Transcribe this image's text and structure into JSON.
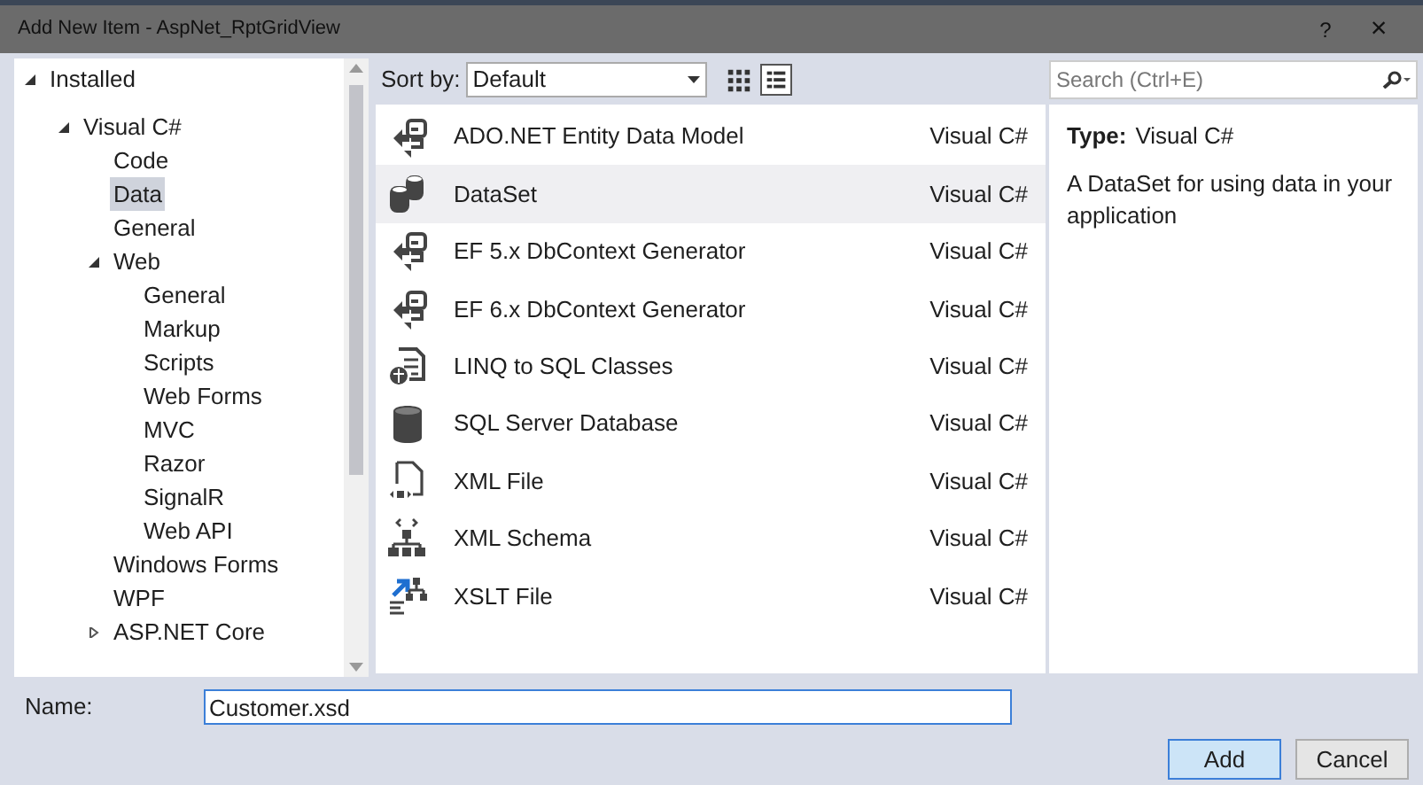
{
  "window": {
    "title": "Add New Item - AspNet_RptGridView",
    "help": "?",
    "close": "×"
  },
  "tree": [
    {
      "label": "Installed",
      "expanded": true,
      "selected": false,
      "children": [
        {
          "label": "Visual C#",
          "expanded": true,
          "selected": false,
          "children": [
            {
              "label": "Code",
              "selected": false
            },
            {
              "label": "Data",
              "selected": true
            },
            {
              "label": "General",
              "selected": false
            },
            {
              "label": "Web",
              "expanded": true,
              "selected": false,
              "children": [
                {
                  "label": "General",
                  "selected": false
                },
                {
                  "label": "Markup",
                  "selected": false
                },
                {
                  "label": "Scripts",
                  "selected": false
                },
                {
                  "label": "Web Forms",
                  "selected": false
                },
                {
                  "label": "MVC",
                  "selected": false
                },
                {
                  "label": "Razor",
                  "selected": false
                },
                {
                  "label": "SignalR",
                  "selected": false
                },
                {
                  "label": "Web API",
                  "selected": false
                }
              ]
            },
            {
              "label": "Windows Forms",
              "selected": false
            },
            {
              "label": "WPF",
              "selected": false
            },
            {
              "label": "ASP.NET Core",
              "expanded": false,
              "selected": false
            }
          ]
        }
      ]
    }
  ],
  "toolbar": {
    "sort_label": "Sort by:",
    "sort_value": "Default",
    "views": [
      {
        "kind": "grid",
        "selected": false
      },
      {
        "kind": "list",
        "selected": true
      }
    ]
  },
  "search": {
    "placeholder": "Search (Ctrl+E)"
  },
  "templates": [
    {
      "kind": "entity",
      "name": "ADO.NET Entity Data Model",
      "language": "Visual C#",
      "selected": false
    },
    {
      "kind": "dataset",
      "name": "DataSet",
      "language": "Visual C#",
      "selected": true
    },
    {
      "kind": "entity",
      "name": "EF 5.x DbContext Generator",
      "language": "Visual C#",
      "selected": false
    },
    {
      "kind": "entity",
      "name": "EF 6.x DbContext Generator",
      "language": "Visual C#",
      "selected": false
    },
    {
      "kind": "linq",
      "name": "LINQ to SQL Classes",
      "language": "Visual C#",
      "selected": false
    },
    {
      "kind": "database",
      "name": "SQL Server Database",
      "language": "Visual C#",
      "selected": false
    },
    {
      "kind": "xmlfile",
      "name": "XML File",
      "language": "Visual C#",
      "selected": false
    },
    {
      "kind": "schema",
      "name": "XML Schema",
      "language": "Visual C#",
      "selected": false
    },
    {
      "kind": "xslt",
      "name": "XSLT File",
      "language": "Visual C#",
      "selected": false
    }
  ],
  "details": {
    "type_label": "Type:",
    "type_value": "Visual C#",
    "description": "A DataSet for using data in your application"
  },
  "name_field": {
    "label": "Name:",
    "value": "Customer.xsd"
  },
  "buttons": [
    {
      "label": "Add",
      "primary": true
    },
    {
      "label": "Cancel",
      "primary": false
    }
  ]
}
